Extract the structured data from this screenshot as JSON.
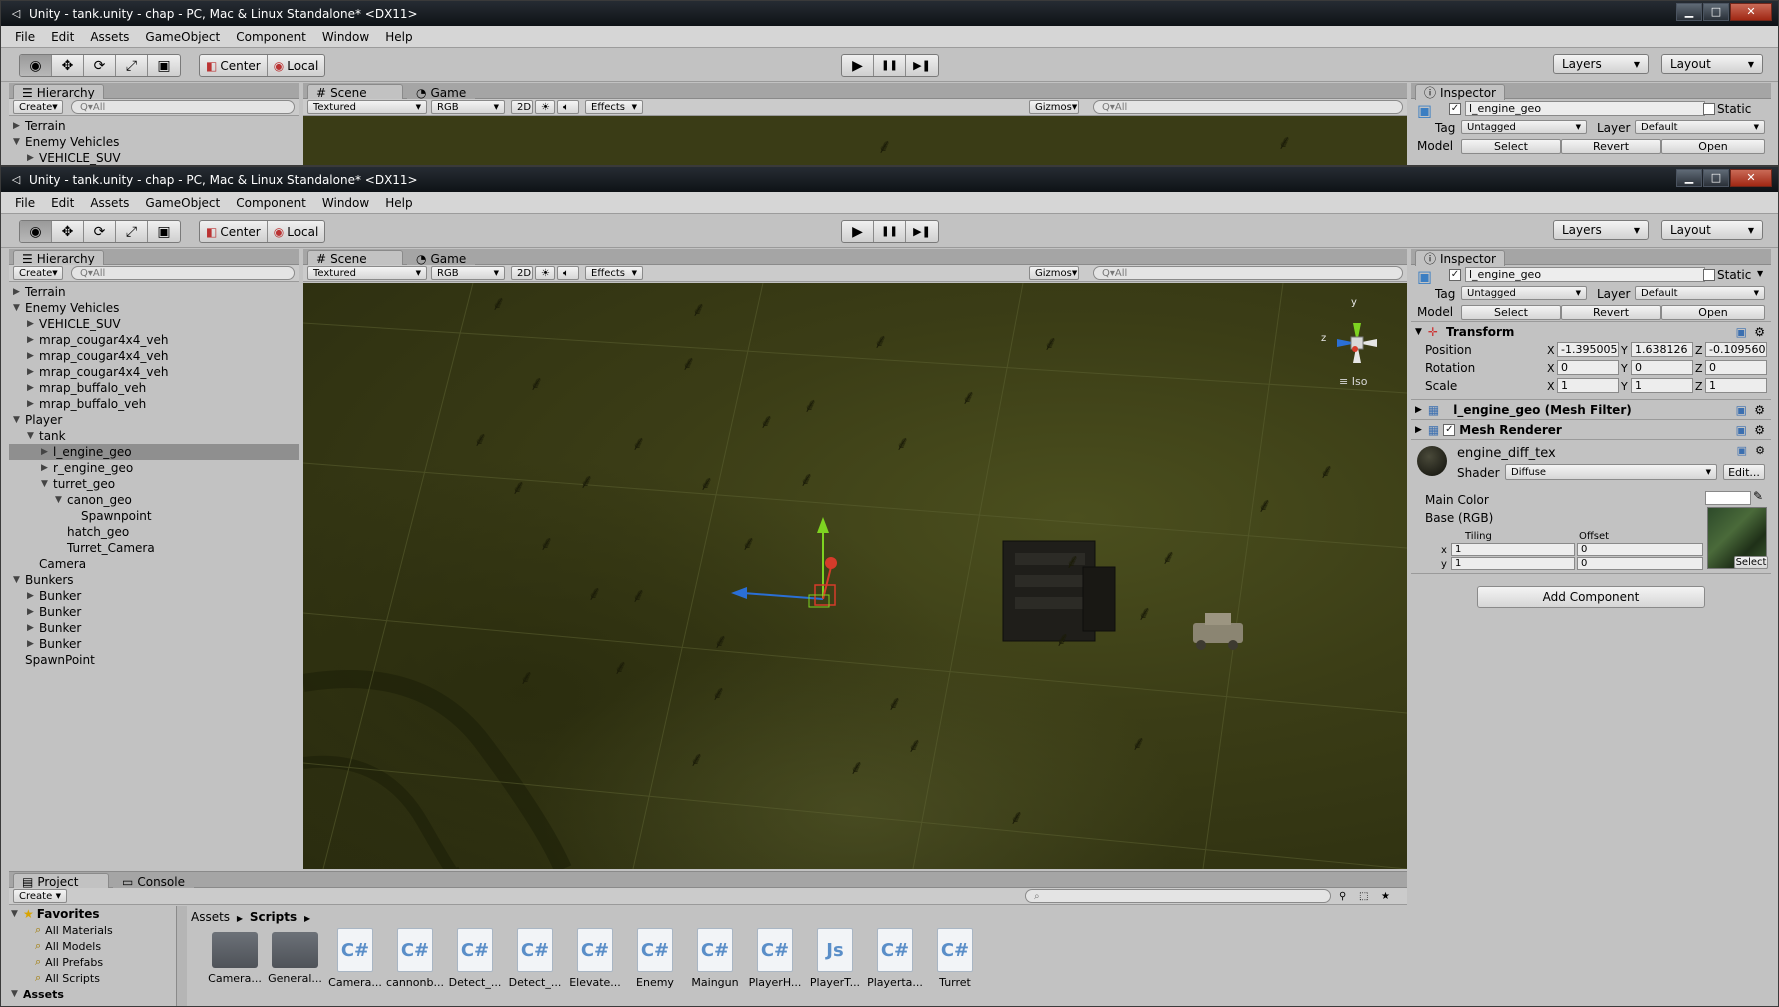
{
  "window": {
    "title": "Unity - tank.unity - chap - PC, Mac & Linux Standalone* <DX11>",
    "controls": {
      "minimize": "▁",
      "maximize": "□",
      "close": "✕"
    }
  },
  "menu": [
    "File",
    "Edit",
    "Assets",
    "GameObject",
    "Component",
    "Window",
    "Help"
  ],
  "toolbar": {
    "tools": [
      "eye-icon",
      "move-icon",
      "rotate-icon",
      "scale-icon",
      "rect-icon"
    ],
    "pivot": "Center",
    "space": "Local",
    "play": "▶",
    "pause": "❚❚",
    "step": "▶❚",
    "layers": "Layers",
    "layout": "Layout"
  },
  "hierarchy": {
    "tab": "Hierarchy",
    "create": "Create",
    "search_placeholder": "Q▾All",
    "items": [
      {
        "label": "Terrain",
        "depth": 0,
        "arrow": "▶"
      },
      {
        "label": "Enemy Vehicles",
        "depth": 0,
        "arrow": "▼"
      },
      {
        "label": "VEHICLE_SUV",
        "depth": 1,
        "arrow": "▶"
      },
      {
        "label": "mrap_cougar4x4_veh",
        "depth": 1,
        "arrow": "▶"
      },
      {
        "label": "mrap_cougar4x4_veh",
        "depth": 1,
        "arrow": "▶"
      },
      {
        "label": "mrap_cougar4x4_veh",
        "depth": 1,
        "arrow": "▶"
      },
      {
        "label": "mrap_buffalo_veh",
        "depth": 1,
        "arrow": "▶"
      },
      {
        "label": "mrap_buffalo_veh",
        "depth": 1,
        "arrow": "▶"
      },
      {
        "label": "Player",
        "depth": 0,
        "arrow": "▼"
      },
      {
        "label": "tank",
        "depth": 1,
        "arrow": "▼"
      },
      {
        "label": "l_engine_geo",
        "depth": 2,
        "arrow": "▶",
        "selected": true
      },
      {
        "label": "r_engine_geo",
        "depth": 2,
        "arrow": "▶"
      },
      {
        "label": "turret_geo",
        "depth": 2,
        "arrow": "▼"
      },
      {
        "label": "canon_geo",
        "depth": 3,
        "arrow": "▼"
      },
      {
        "label": "Spawnpoint",
        "depth": 4,
        "arrow": ""
      },
      {
        "label": "hatch_geo",
        "depth": 3,
        "arrow": ""
      },
      {
        "label": "Turret_Camera",
        "depth": 3,
        "arrow": ""
      },
      {
        "label": "Camera",
        "depth": 1,
        "arrow": ""
      },
      {
        "label": "Bunkers",
        "depth": 0,
        "arrow": "▼"
      },
      {
        "label": "Bunker",
        "depth": 1,
        "arrow": "▶"
      },
      {
        "label": "Bunker",
        "depth": 1,
        "arrow": "▶"
      },
      {
        "label": "Bunker",
        "depth": 1,
        "arrow": "▶"
      },
      {
        "label": "Bunker",
        "depth": 1,
        "arrow": "▶"
      },
      {
        "label": "SpawnPoint",
        "depth": 0,
        "arrow": ""
      }
    ]
  },
  "scene": {
    "tab_scene": "Scene",
    "tab_game": "Game",
    "shading": "Textured",
    "render_mode": "RGB",
    "mode_2d": "2D",
    "effects": "Effects",
    "gizmos": "Gizmos",
    "search_placeholder": "Q▾All",
    "projection": "≡ Iso",
    "axis_labels": {
      "y": "y",
      "z": "z"
    }
  },
  "inspector": {
    "tab": "Inspector",
    "object_name": "l_engine_geo",
    "static_label": "Static",
    "tag_label": "Tag",
    "tag_value": "Untagged",
    "layer_label": "Layer",
    "layer_value": "Default",
    "model_label": "Model",
    "model_buttons": [
      "Select",
      "Revert",
      "Open"
    ],
    "transform": {
      "title": "Transform",
      "rows": [
        {
          "label": "Position",
          "x": "-1.395005",
          "y": "1.638126",
          "z": "-0.109560"
        },
        {
          "label": "Rotation",
          "x": "0",
          "y": "0",
          "z": "0"
        },
        {
          "label": "Scale",
          "x": "1",
          "y": "1",
          "z": "1"
        }
      ]
    },
    "mesh_filter": "l_engine_geo (Mesh Filter)",
    "mesh_renderer": "Mesh Renderer",
    "material": {
      "name": "engine_diff_tex",
      "shader_label": "Shader",
      "shader_value": "Diffuse",
      "edit": "Edit...",
      "main_color": "Main Color",
      "base": "Base (RGB)",
      "tiling": "Tiling",
      "offset": "Offset",
      "x_label": "x",
      "y_label": "y",
      "tiling_x": "1",
      "tiling_y": "1",
      "offset_x": "0",
      "offset_y": "0",
      "select": "Select"
    },
    "add_component": "Add Component"
  },
  "project": {
    "tab_project": "Project",
    "tab_console": "Console",
    "create": "Create",
    "favorites": "Favorites",
    "favorite_items": [
      "All Materials",
      "All Models",
      "All Prefabs",
      "All Scripts"
    ],
    "assets_label": "Assets",
    "breadcrumb": [
      "Assets",
      "Scripts"
    ],
    "files": [
      {
        "name": "Camera...",
        "type": "folder"
      },
      {
        "name": "General...",
        "type": "folder"
      },
      {
        "name": "Camera...",
        "type": "cs"
      },
      {
        "name": "cannonb...",
        "type": "cs"
      },
      {
        "name": "Detect_...",
        "type": "cs"
      },
      {
        "name": "Detect_...",
        "type": "cs"
      },
      {
        "name": "Elevate...",
        "type": "cs"
      },
      {
        "name": "Enemy",
        "type": "cs"
      },
      {
        "name": "Maingun",
        "type": "cs"
      },
      {
        "name": "PlayerH...",
        "type": "cs"
      },
      {
        "name": "PlayerT...",
        "type": "js"
      },
      {
        "name": "Playerta...",
        "type": "cs"
      },
      {
        "name": "Turret",
        "type": "cs"
      }
    ],
    "file_icon_labels": {
      "cs": "C#",
      "js": "Js"
    }
  },
  "colors": {
    "terrain_dark": "#2a2c0f",
    "terrain_light": "#4b4f1e",
    "axis_x": "#d63b2a",
    "axis_y": "#7ed321",
    "axis_z": "#2a6fd6",
    "selection": "#8f8f8f"
  }
}
